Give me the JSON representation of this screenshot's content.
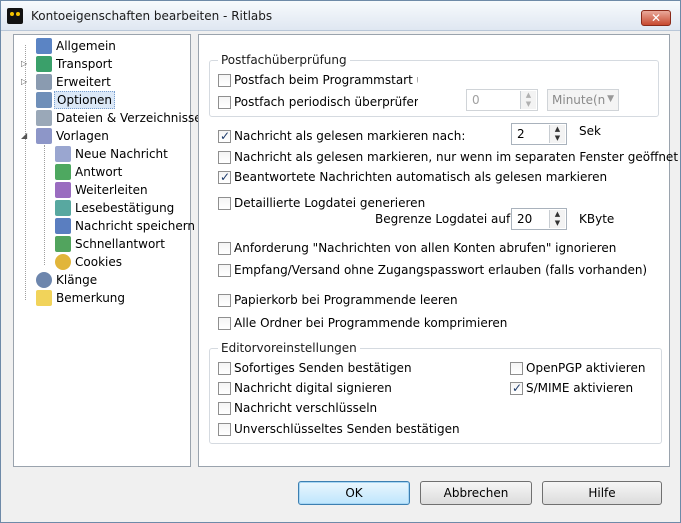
{
  "window": {
    "title": "Kontoeigenschaften bearbeiten - Ritlabs",
    "close_glyph": "✕"
  },
  "colors": {
    "selection": "#dbe8f7",
    "default_button": "#bee6fd"
  },
  "tree": {
    "items": [
      {
        "label": "Allgemein",
        "icon": "person-card-icon"
      },
      {
        "label": "Transport",
        "icon": "transport-icon"
      },
      {
        "label": "Erweitert",
        "icon": "advanced-icon"
      },
      {
        "label": "Optionen",
        "icon": "options-icon"
      },
      {
        "label": "Dateien & Verzeichnisse",
        "icon": "files-icon"
      },
      {
        "label": "Vorlagen",
        "icon": "templates-icon"
      },
      {
        "label": "Neue Nachricht",
        "icon": "new-message-icon"
      },
      {
        "label": "Antwort",
        "icon": "reply-icon"
      },
      {
        "label": "Weiterleiten",
        "icon": "forward-icon"
      },
      {
        "label": "Lesebestätigung",
        "icon": "read-receipt-icon"
      },
      {
        "label": "Nachricht speichern",
        "icon": "save-message-icon"
      },
      {
        "label": "Schnellantwort",
        "icon": "quick-reply-icon"
      },
      {
        "label": "Cookies",
        "icon": "cookies-icon"
      },
      {
        "label": "Klänge",
        "icon": "sound-icon"
      },
      {
        "label": "Bemerkung",
        "icon": "note-icon"
      }
    ]
  },
  "options": {
    "mailcheck": {
      "title": "Postfachüberprüfung",
      "on_start": "Postfach beim Programmstart über",
      "periodic": "Postfach periodisch überprüfen alle",
      "periodic_value": "0",
      "unit": "Minute(n"
    },
    "mark_read_after": "Nachricht als gelesen markieren nach:",
    "mark_read_value": "2",
    "mark_read_unit": "Sek",
    "mark_read_separate": "Nachricht als gelesen markieren, nur wenn im separaten Fenster geöffnet",
    "mark_replied_read": "Beantwortete Nachrichten automatisch als gelesen markieren",
    "detailed_log": "Detaillierte Logdatei generieren",
    "limit_log": "Begrenze Logdatei auf:",
    "limit_log_value": "20",
    "limit_log_unit": "KByte",
    "ignore_all_accounts": "Anforderung \"Nachrichten von allen Konten abrufen\" ignorieren",
    "no_password": "Empfang/Versand ohne Zugangspasswort erlauben (falls vorhanden)",
    "empty_trash": "Papierkorb bei Programmende leeren",
    "compress_folders": "Alle Ordner bei Programmende komprimieren",
    "editor": {
      "title": "Editorvoreinstellungen",
      "confirm_send": "Sofortiges Senden bestätigen",
      "sign": "Nachricht digital signieren",
      "encrypt": "Nachricht verschlüsseln",
      "confirm_unencrypted": "Unverschlüsseltes Senden bestätigen",
      "openpgp": "OpenPGP aktivieren",
      "smime": "S/MIME aktivieren"
    }
  },
  "buttons": {
    "ok": "OK",
    "cancel": "Abbrechen",
    "help": "Hilfe"
  }
}
